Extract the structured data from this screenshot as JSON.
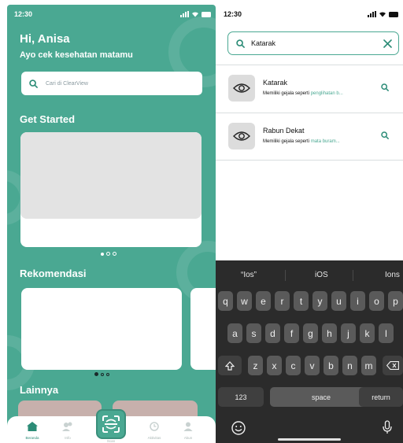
{
  "colors": {
    "primary": "#4aa892",
    "card_placeholder": "#e3e3e3",
    "highlight": "#4aa892",
    "keyboard_bg": "#2b2b2b"
  },
  "left": {
    "status_time": "12:30",
    "greeting": "Hi, Anisa",
    "subtitle": "Ayo cek kesehatan matamu",
    "search": {
      "placeholder": "Cari di ClearView",
      "icon": "search-icon"
    },
    "sections": {
      "get_started": "Get Started",
      "rekomendasi": "Rekomendasi",
      "lainnya": "Lainnya"
    },
    "carousel": {
      "pages": 3,
      "active": 0
    },
    "rekomendasi_carousel": {
      "pages": 3,
      "active": 0
    },
    "nav": [
      {
        "label": "Beranda",
        "icon": "home-icon",
        "active": true
      },
      {
        "label": "Info",
        "icon": "users-icon",
        "active": false
      },
      {
        "label": "Scan",
        "icon": "scan-icon",
        "active": false
      },
      {
        "label": "Aktivitas",
        "icon": "clock-icon",
        "active": false
      },
      {
        "label": "Akun",
        "icon": "user-icon",
        "active": false
      }
    ]
  },
  "right": {
    "status_time": "12:30",
    "search": {
      "value": "Katarak",
      "icon": "search-icon",
      "clear_icon": "close-icon"
    },
    "results": [
      {
        "title": "Katarak",
        "desc_prefix": "Memiliki gejala seperti ",
        "desc_highlight": "penglihatan b...",
        "icon": "eye-icon"
      },
      {
        "title": "Rabun Dekat",
        "desc_prefix": "Memiliki gejala seperti ",
        "desc_highlight": "mata buram...",
        "icon": "eye-icon"
      }
    ],
    "keyboard": {
      "suggestions": [
        "“Ios”",
        "iOS",
        "Ions"
      ],
      "row1": [
        "q",
        "w",
        "e",
        "r",
        "t",
        "y",
        "u",
        "i",
        "o",
        "p"
      ],
      "row2": [
        "a",
        "s",
        "d",
        "f",
        "g",
        "h",
        "j",
        "k",
        "l"
      ],
      "row3": [
        "z",
        "x",
        "c",
        "v",
        "b",
        "n",
        "m"
      ],
      "numbers_key": "123",
      "space_key": "space",
      "return_key": "return"
    }
  }
}
